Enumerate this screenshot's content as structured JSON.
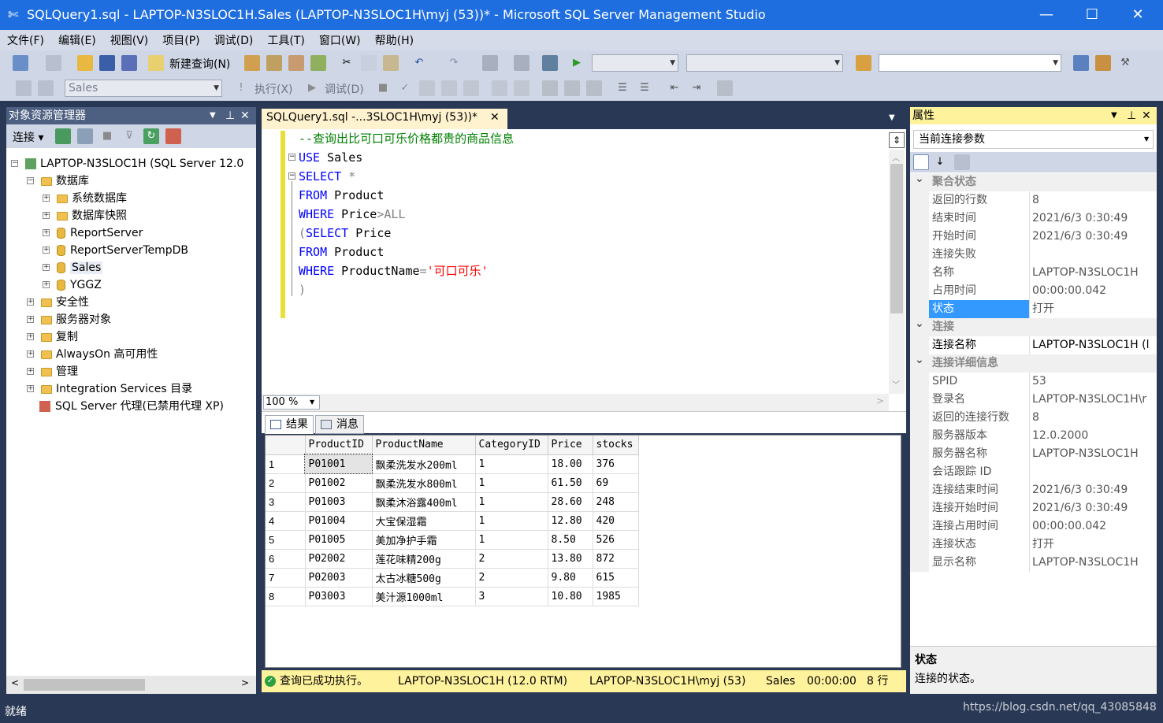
{
  "window": {
    "title": "SQLQuery1.sql - LAPTOP-N3SLOC1H.Sales (LAPTOP-N3SLOC1H\\myj (53))* - Microsoft SQL Server Management Studio"
  },
  "menu": [
    "文件(F)",
    "编辑(E)",
    "视图(V)",
    "项目(P)",
    "调试(D)",
    "工具(T)",
    "窗口(W)",
    "帮助(H)"
  ],
  "toolbar": {
    "new_query": "新建查询(N)",
    "database": "Sales",
    "execute": "执行(X)",
    "debug": "调试(D)"
  },
  "object_explorer": {
    "title": "对象资源管理器",
    "connect": "连接",
    "server": "LAPTOP-N3SLOC1H (SQL Server 12.0",
    "databases": "数据库",
    "db_items": [
      "系统数据库",
      "数据库快照",
      "ReportServer",
      "ReportServerTempDB",
      "Sales",
      "YGGZ"
    ],
    "other_nodes": [
      "安全性",
      "服务器对象",
      "复制",
      "AlwaysOn 高可用性",
      "管理",
      "Integration Services 目录"
    ],
    "agent": "SQL Server 代理(已禁用代理 XP)"
  },
  "editor": {
    "tab": "SQLQuery1.sql -...3SLOC1H\\myj (53))*",
    "zoom": "100 %",
    "code": {
      "comment": "--查询出比可口可乐价格都贵的商品信息",
      "kw_use": "USE",
      "db": " Sales",
      "kw_select": "SELECT",
      "star": " *",
      "kw_from": "FROM",
      "table": " Product",
      "kw_where": "WHERE",
      "price_cond": " Price",
      "gt": ">ALL",
      "paren_open": "(",
      "kw_select2": "SELECT",
      "price2": " Price",
      "kw_from2": "FROM",
      "table2": " Product",
      "kw_where2": "WHERE",
      "name_cond": " ProductName",
      "eq": "=",
      "literal": "'可口可乐'",
      "paren_close": ")"
    }
  },
  "results": {
    "tab_results": "结果",
    "tab_messages": "消息",
    "columns": [
      "ProductID",
      "ProductName",
      "CategoryID",
      "Price",
      "stocks"
    ],
    "rows": [
      [
        "1",
        "P01001",
        "飘柔洗发水200ml",
        "1",
        "18.00",
        "376"
      ],
      [
        "2",
        "P01002",
        "飘柔洗发水800ml",
        "1",
        "61.50",
        "69"
      ],
      [
        "3",
        "P01003",
        "飘柔沐浴露400ml",
        "1",
        "28.60",
        "248"
      ],
      [
        "4",
        "P01004",
        "大宝保湿霜",
        "1",
        "12.80",
        "420"
      ],
      [
        "5",
        "P01005",
        "美加净护手霜",
        "1",
        "8.50",
        "526"
      ],
      [
        "6",
        "P02002",
        "莲花味精200g",
        "2",
        "13.80",
        "872"
      ],
      [
        "7",
        "P02003",
        "太古冰糖500g",
        "2",
        "9.80",
        "615"
      ],
      [
        "8",
        "P03003",
        "美汁源1000ml",
        "3",
        "10.80",
        "1985"
      ]
    ]
  },
  "query_status": {
    "message": "查询已成功执行。",
    "server": "LAPTOP-N3SLOC1H (12.0 RTM)",
    "user": "LAPTOP-N3SLOC1H\\myj (53)",
    "db": "Sales",
    "time": "00:00:00",
    "rows": "8 行"
  },
  "properties": {
    "title": "属性",
    "selector": "当前连接参数",
    "cat1": "聚合状态",
    "cat2": "连接",
    "cat3": "连接详细信息",
    "agg": [
      {
        "name": "返回的行数",
        "value": "8"
      },
      {
        "name": "结束时间",
        "value": "2021/6/3 0:30:49"
      },
      {
        "name": "开始时间",
        "value": "2021/6/3 0:30:49"
      },
      {
        "name": "连接失败",
        "value": ""
      },
      {
        "name": "名称",
        "value": "LAPTOP-N3SLOC1H"
      },
      {
        "name": "占用时间",
        "value": "00:00:00.042"
      },
      {
        "name": "状态",
        "value": "打开"
      }
    ],
    "conn": [
      {
        "name": "连接名称",
        "value": "LAPTOP-N3SLOC1H (l"
      }
    ],
    "details": [
      {
        "name": "SPID",
        "value": "53"
      },
      {
        "name": "登录名",
        "value": "LAPTOP-N3SLOC1H\\r"
      },
      {
        "name": "返回的连接行数",
        "value": "8"
      },
      {
        "name": "服务器版本",
        "value": "12.0.2000"
      },
      {
        "name": "服务器名称",
        "value": "LAPTOP-N3SLOC1H"
      },
      {
        "name": "会话跟踪 ID",
        "value": ""
      },
      {
        "name": "连接结束时间",
        "value": "2021/6/3 0:30:49"
      },
      {
        "name": "连接开始时间",
        "value": "2021/6/3 0:30:49"
      },
      {
        "name": "连接占用时间",
        "value": "00:00:00.042"
      },
      {
        "name": "连接状态",
        "value": "打开"
      },
      {
        "name": "显示名称",
        "value": "LAPTOP-N3SLOC1H"
      }
    ],
    "desc_title": "状态",
    "desc_text": "连接的状态。"
  },
  "statusbar": {
    "left": "就绪",
    "watermark": "https://blog.csdn.net/qq_43085848"
  },
  "colors": {
    "accent": "#1f6ee0",
    "frame": "#293955",
    "tab_active": "#fff3cf",
    "status_yellow": "#fff29d",
    "selected": "#3399ff"
  }
}
